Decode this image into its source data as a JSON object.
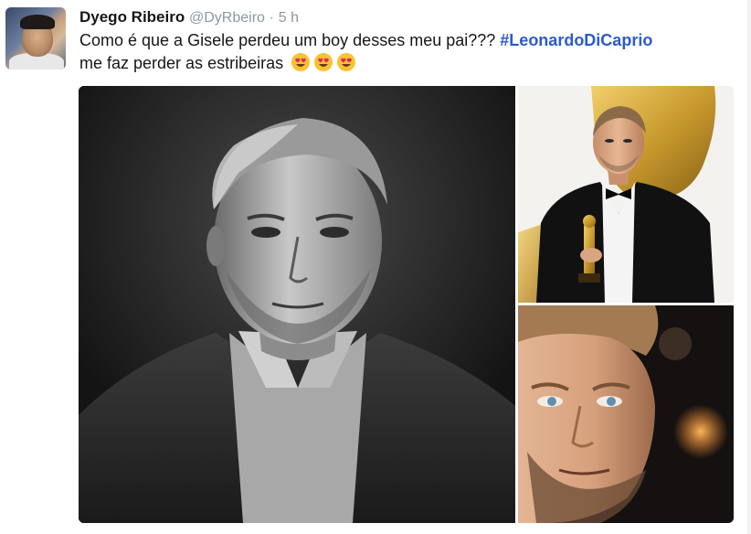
{
  "tweet": {
    "author_name": "Dyego Ribeiro",
    "handle": "@DyRbeiro",
    "separator": "·",
    "time": "5 h",
    "text_line1_prefix": "Como é que a Gisele perdeu um boy desses meu pai???",
    "hashtag": "#LeonardoDiCaprio",
    "text_line2": "me faz perder as estribeiras",
    "emojis": [
      "heart-eyes-emoji",
      "heart-eyes-emoji",
      "heart-eyes-emoji"
    ]
  },
  "media": {
    "images": [
      {
        "name": "portrait-black-and-white",
        "tone": "monochrome"
      },
      {
        "name": "oscar-tuxedo-photo",
        "tone": "color"
      },
      {
        "name": "closeup-face-photo",
        "tone": "color"
      }
    ]
  },
  "colors": {
    "hashtag": "#2b5bcc",
    "muted": "#8899a6",
    "text": "#14171a"
  }
}
